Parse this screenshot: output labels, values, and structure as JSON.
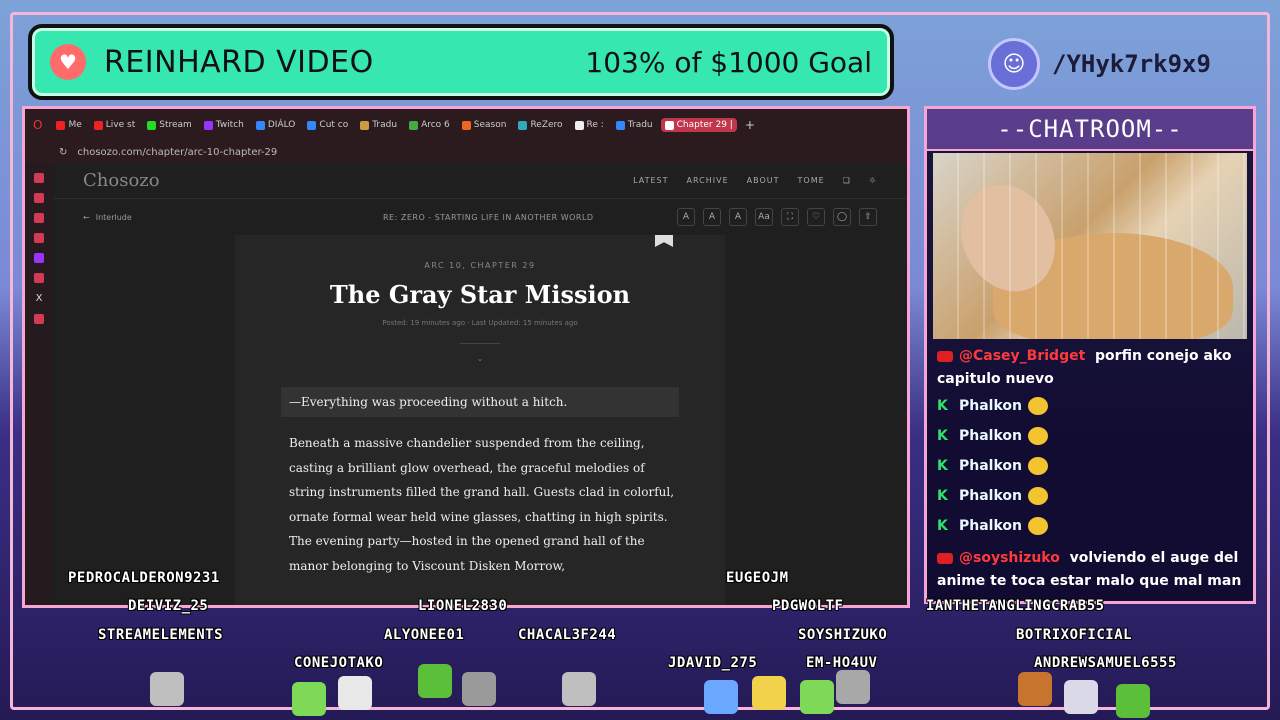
{
  "goal": {
    "title": "REINHARD VIDEO",
    "amount": "103% of $1000 Goal"
  },
  "discord": {
    "handle": "/YHyk7rk9x9"
  },
  "browser": {
    "tabs": [
      "Me",
      "Live st",
      "Stream",
      "Twitch",
      "DIÁLO",
      "Cut co",
      "Tradu",
      "Arco 6",
      "Season",
      "ReZero",
      "Re :",
      "Tradu",
      "Chapter 29 |"
    ],
    "url": "chosozo.com/chapter/arc-10-chapter-29"
  },
  "site": {
    "logo": "Chosozo",
    "nav": [
      "LATEST",
      "ARCHIVE",
      "ABOUT",
      "TOME"
    ],
    "back": "Interlude",
    "series": "RE: ZERO - STARTING LIFE IN ANOTHER WORLD",
    "tools": [
      "A",
      "A",
      "A",
      "Aa"
    ]
  },
  "article": {
    "chapter": "ARC 10, CHAPTER 29",
    "title": "The Gray Star Mission",
    "meta": "Posted: 19 minutes ago · Last Updated: 15 minutes ago",
    "quote": "—Everything was proceeding without a hitch.",
    "body": "Beneath a massive chandelier suspended from the ceiling, casting a brilliant glow overhead, the graceful melodies of string instruments filled the grand hall. Guests clad in colorful, ornate formal wear held wine glasses, chatting in high spirits. The evening party—hosted in the opened grand hall of the manor belonging to Viscount Disken Morrow,"
  },
  "chat": {
    "header": "--CHATROOM--",
    "messages": [
      {
        "platform": "youtube",
        "user": "@Casey_Bridget",
        "text": "porfin conejo ako capitulo nuevo"
      },
      {
        "platform": "kick",
        "user": "Phalkon",
        "text": ""
      },
      {
        "platform": "kick",
        "user": "Phalkon",
        "text": ""
      },
      {
        "platform": "kick",
        "user": "Phalkon",
        "text": ""
      },
      {
        "platform": "kick",
        "user": "Phalkon",
        "text": ""
      },
      {
        "platform": "kick",
        "user": "Phalkon",
        "text": ""
      },
      {
        "platform": "youtube",
        "user": "@soyshizuko",
        "text": "volviendo el auge del anime te toca estar malo que mal man"
      }
    ]
  },
  "viewers": [
    "PEDROCALDERON9231",
    "DEIVIZ_25",
    "STREAMELEMENTS",
    "CONEJOTAKO",
    "LIONEL2830",
    "ALYONEE01",
    "CHACAL3F244",
    "EUGEOJM",
    "PDGWOLTF",
    "SOYSHIZUKO",
    "JDAVID_275",
    "EM-HO4UV",
    "IANTHETANGLINGCRAB55",
    "BOTRIXOFICIAL",
    "ANDREWSAMUEL6555"
  ],
  "colors": {
    "goal": "#36e8b0",
    "frame": "#f7a6d3",
    "youtube": "#ff3a3a",
    "kick": "#2fe26b"
  }
}
